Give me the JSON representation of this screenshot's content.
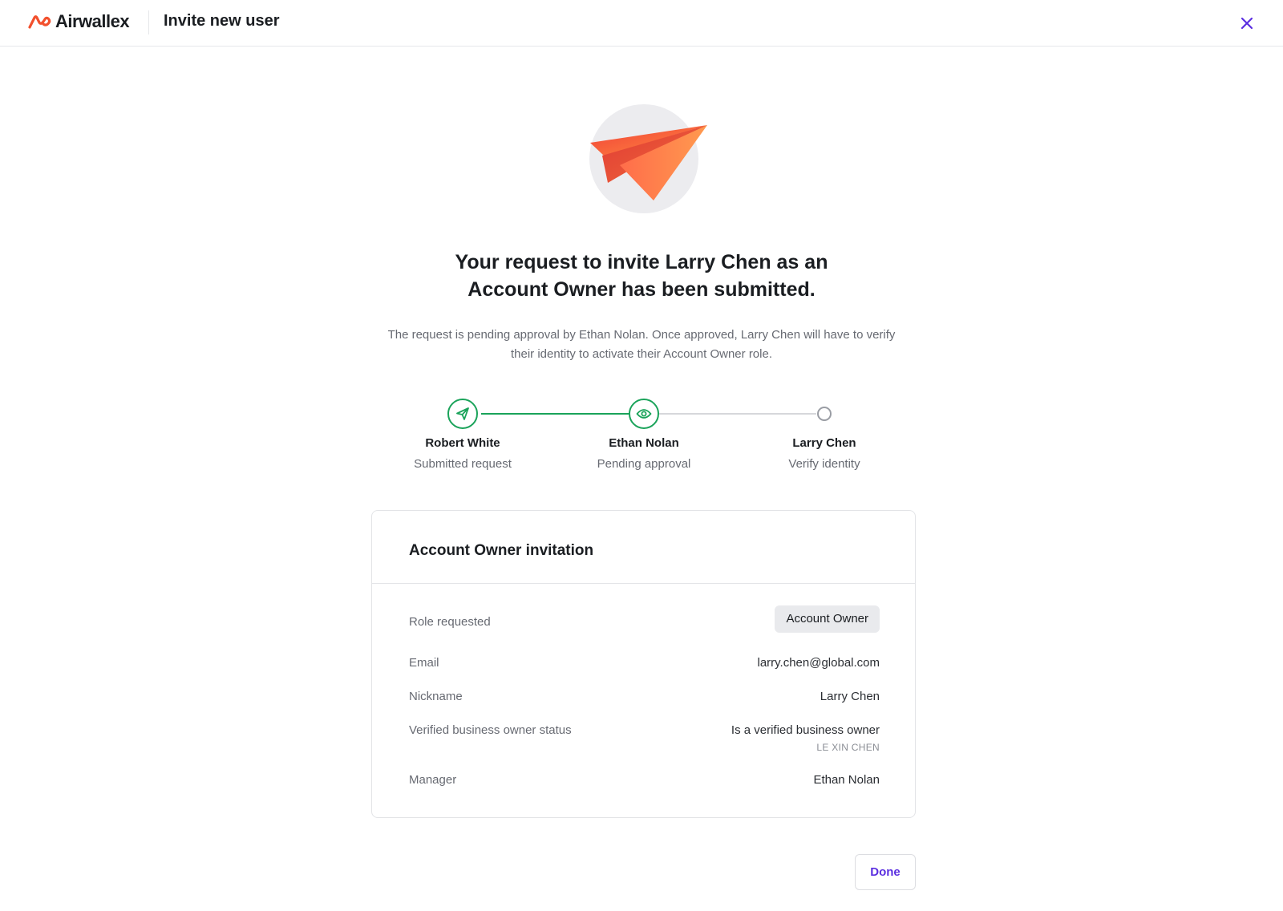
{
  "header": {
    "brand": "Airwallex",
    "title": "Invite new user"
  },
  "hero": {
    "illustration": "paper-plane",
    "headline_line1": "Your request to invite Larry Chen as an",
    "headline_line2": "Account Owner has been submitted.",
    "subtext_line1": "The request is pending approval by Ethan Nolan. Once approved, Larry Chen will have to verify",
    "subtext_line2": "their identity to activate their Account Owner role."
  },
  "stepper": {
    "steps": [
      {
        "name": "Robert White",
        "desc": "Submitted request",
        "status": "done",
        "icon": "send-icon"
      },
      {
        "name": "Ethan Nolan",
        "desc": "Pending approval",
        "status": "current",
        "icon": "eye-icon"
      },
      {
        "name": "Larry Chen",
        "desc": "Verify identity",
        "status": "pending",
        "icon": "empty-circle"
      }
    ]
  },
  "card": {
    "title": "Account Owner invitation",
    "rows": [
      {
        "label": "Role requested",
        "value": "Account Owner"
      },
      {
        "label": "Email",
        "value": "larry.chen@global.com"
      },
      {
        "label": "Nickname",
        "value": "Larry Chen"
      },
      {
        "label": "Verified business owner status",
        "value": "Is a verified business owner",
        "sub": "LE XIN CHEN"
      },
      {
        "label": "Manager",
        "value": "Ethan Nolan"
      }
    ]
  },
  "actions": {
    "done_label": "Done"
  },
  "colors": {
    "brand_orange": "#f2502d",
    "success_green": "#1aa35a",
    "accent_purple": "#5b2fe0"
  }
}
